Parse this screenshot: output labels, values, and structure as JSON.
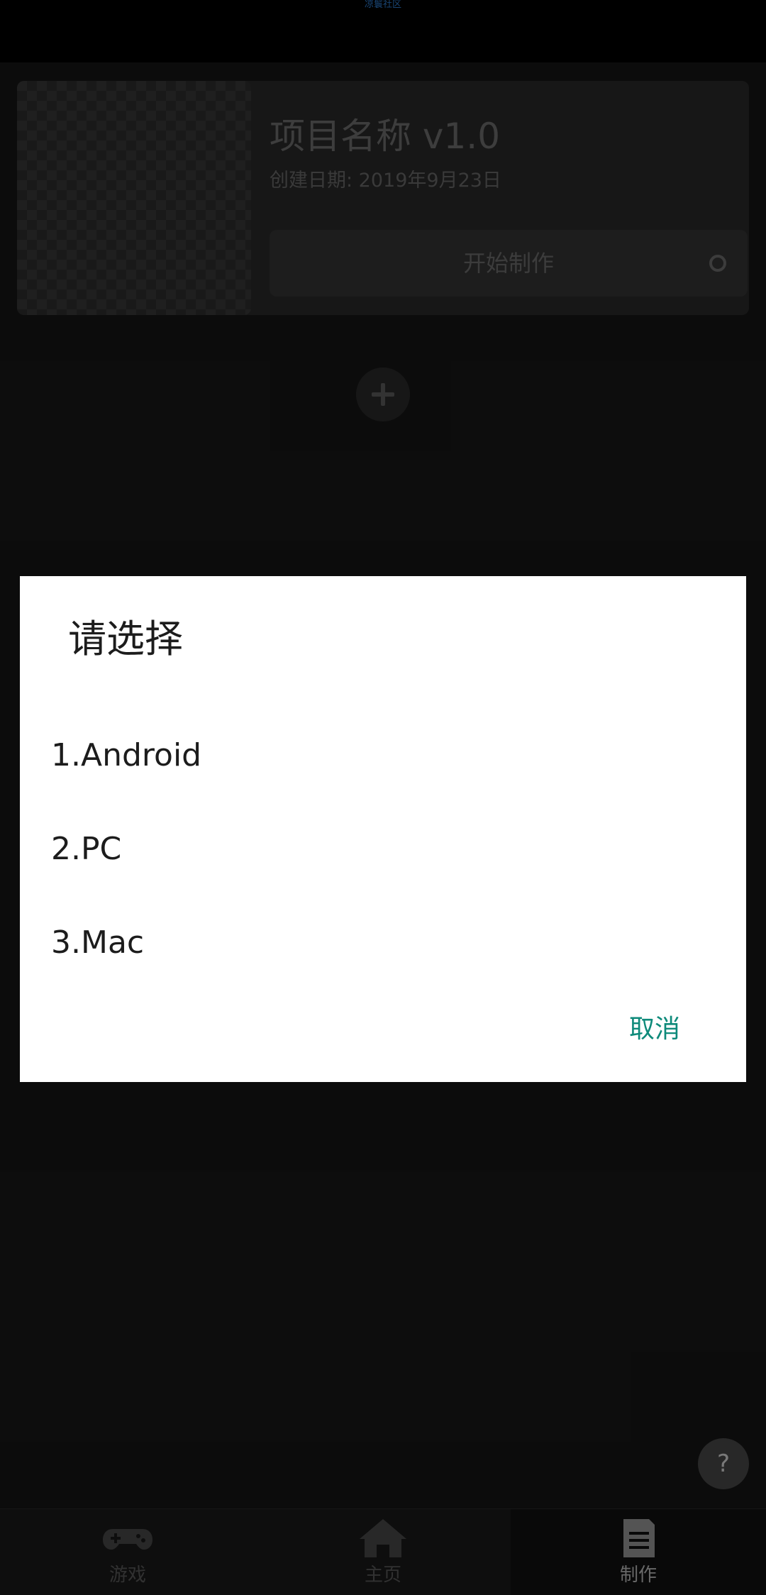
{
  "status_bar": {
    "text": "凉鬟社区"
  },
  "project": {
    "title": "项目名称 v1.0",
    "date": "创建日期: 2019年9月23日",
    "start_label": "开始制作"
  },
  "help": {
    "label": "?"
  },
  "bottom_nav": {
    "tabs": [
      {
        "label": "游戏",
        "icon": "gamepad-icon",
        "active": false
      },
      {
        "label": "主页",
        "icon": "home-icon",
        "active": false
      },
      {
        "label": "制作",
        "icon": "document-icon",
        "active": true
      }
    ]
  },
  "dialog": {
    "title": "请选择",
    "options": [
      "1.Android",
      "2.PC",
      "3.Mac"
    ],
    "cancel_label": "取消",
    "accent_color": "#0d8a7a"
  }
}
